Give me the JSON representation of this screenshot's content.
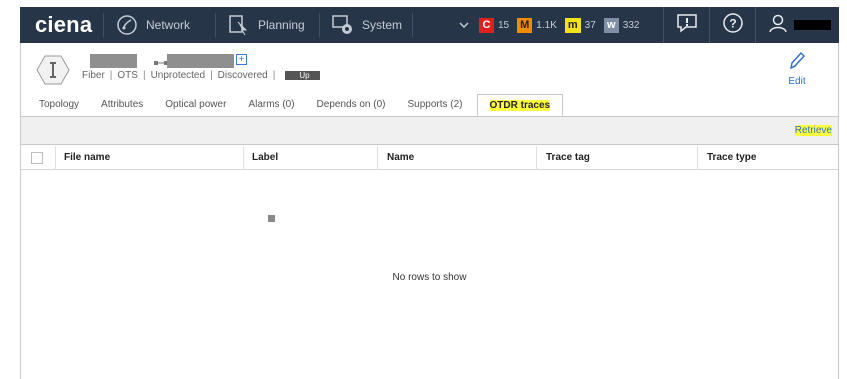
{
  "topbar": {
    "logo": "ciena",
    "nav": [
      {
        "label": "Network",
        "icon": "network-globe-icon"
      },
      {
        "label": "Planning",
        "icon": "planning-icon"
      },
      {
        "label": "System",
        "icon": "system-gear-icon"
      }
    ],
    "alarms": [
      {
        "code": "C",
        "count": "15",
        "color": "#e02020"
      },
      {
        "code": "M",
        "count": "1.1K",
        "color": "#f08c00"
      },
      {
        "code": "m",
        "count": "37",
        "color": "#f2e21a"
      },
      {
        "code": "w",
        "count": "332",
        "color": "#7f8fa6"
      }
    ],
    "colors": {
      "background": "#263547"
    }
  },
  "header": {
    "meta": {
      "type": "Fiber",
      "layer": "OTS",
      "protection": "Unprotected",
      "state": "Discovered",
      "status": "Up"
    },
    "edit_label": "Edit"
  },
  "tabs": [
    {
      "label": "Topology"
    },
    {
      "label": "Attributes"
    },
    {
      "label": "Optical power"
    },
    {
      "label": "Alarms (0)"
    },
    {
      "label": "Depends on (0)"
    },
    {
      "label": "Supports (2)"
    },
    {
      "label": "OTDR traces",
      "active": true
    }
  ],
  "toolbar": {
    "retrieve_label": "Retrieve"
  },
  "grid": {
    "columns": [
      "File name",
      "Label",
      "Name",
      "Trace tag",
      "Trace type"
    ],
    "empty_message": "No rows to show"
  }
}
